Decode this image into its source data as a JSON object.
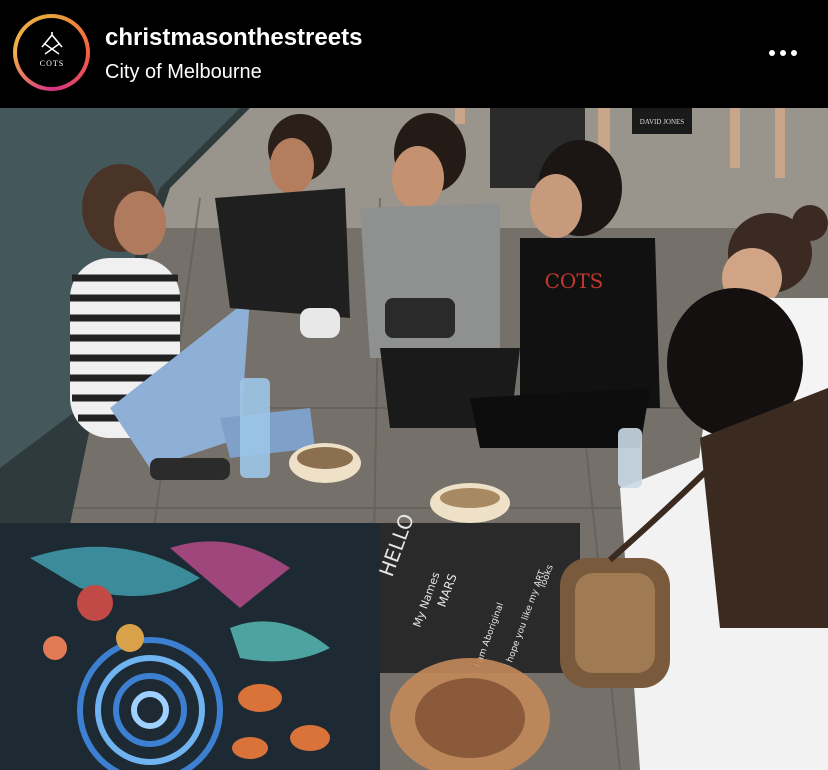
{
  "post": {
    "username": "christmasonthestreets",
    "location": "City of Melbourne",
    "avatar_logo_text": "COTS",
    "more_icon": "more-horizontal-icon"
  },
  "photo": {
    "chalk_words": [
      "HELLO",
      "My Names",
      "MARS",
      "I am Aboriginal",
      "I hope you like my ART",
      "looks"
    ],
    "shirt_text": "COTS",
    "sign_text": "DAVID JONES"
  },
  "colors": {
    "background": "#000000",
    "text": "#ffffff",
    "avatar_ring_start": "#e8a33b",
    "avatar_ring_end": "#d63384"
  }
}
